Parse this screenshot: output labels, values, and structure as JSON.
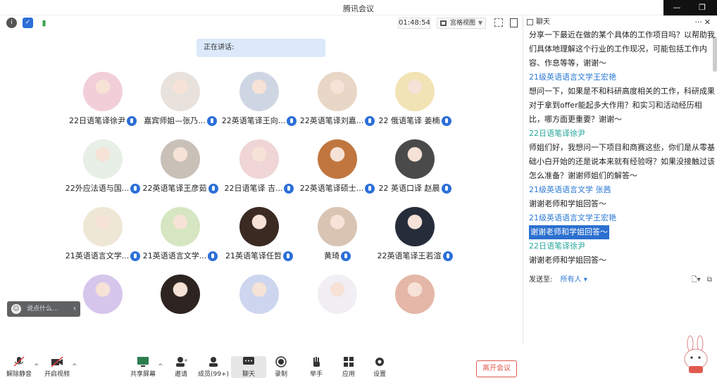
{
  "window": {
    "title": "腾讯会议"
  },
  "topbar": {
    "timer": "01:48:54",
    "view_mode": "宫格视图"
  },
  "speaking": {
    "label": "正在讲话:"
  },
  "participants": [
    {
      "name": "22日语笔译徐尹"
    },
    {
      "name": "嘉宾师姐—张乃..."
    },
    {
      "name": "22英语笔译王向..."
    },
    {
      "name": "22英语笔译刘嘉..."
    },
    {
      "name": "22 俄语笔译 姜楠"
    },
    {
      "name": "22外应法语与国..."
    },
    {
      "name": "22英语笔译王彦茹"
    },
    {
      "name": "22日语笔译 吉..."
    },
    {
      "name": "22英语笔译硕士..."
    },
    {
      "name": "22 英语口译 赵晨"
    },
    {
      "name": "21英语语言文学..."
    },
    {
      "name": "21英语语言文学..."
    },
    {
      "name": "21英语笔译任哲"
    },
    {
      "name": "黄琦"
    },
    {
      "name": "22英语笔译王若渲"
    },
    {
      "name": ""
    },
    {
      "name": ""
    },
    {
      "name": ""
    },
    {
      "name": ""
    },
    {
      "name": ""
    }
  ],
  "say_box": {
    "placeholder": "说点什么..."
  },
  "chat": {
    "title": "聊天",
    "messages": [
      {
        "type": "text",
        "text": "分享一下最近在做的某个具体的工作项目吗？以帮助我们具体地理解这个行业的工作现况，可能包括工作内容、作息等等，谢谢～"
      },
      {
        "type": "sender",
        "color": "blue",
        "text": "21级英语语言文学王宏艳"
      },
      {
        "type": "text",
        "text": "想问一下，如果是不和科研高度相关的工作，科研成果对于拿到offer能起多大作用？和实习和活动经历相比，哪方面更重要？谢谢～"
      },
      {
        "type": "sender",
        "color": "teal",
        "text": "22日语笔译徐尹"
      },
      {
        "type": "text",
        "text": "师姐们好，我想问一下项目和商赛这些，你们是从零基础小白开始的还是说本来就有经验呀？如果没接触过该怎么准备？谢谢师姐们的解答～"
      },
      {
        "type": "sender",
        "color": "blue",
        "text": "21级英语语言文学 张茜"
      },
      {
        "type": "text",
        "text": "谢谢老师和学姐回答～"
      },
      {
        "type": "sender",
        "color": "blue",
        "text": "21级英语语言文学王宏艳"
      },
      {
        "type": "highlight",
        "text": "谢谢老师和学姐回答～"
      },
      {
        "type": "sender",
        "color": "teal",
        "text": "22日语笔译徐尹"
      },
      {
        "type": "text",
        "text": "谢谢老师和学姐回答～"
      }
    ],
    "send_to_label": "发送至:",
    "send_to_value": "所有人"
  },
  "toolbar": {
    "unmute": "解除静音",
    "video": "开启视频",
    "share": "共享屏幕",
    "invite": "邀请",
    "members": "成员(99+)",
    "chat": "聊天",
    "record": "录制",
    "raise_hand": "举手",
    "apps": "应用",
    "settings": "设置",
    "leave": "离开会议"
  },
  "colors": {
    "accent_blue": "#2c6fd8",
    "leave_red": "#e05a4f",
    "teal": "#27a59a",
    "avatar_bgs": [
      "#f2cfd8",
      "#e9e2dc",
      "#cfd6e3",
      "#e8d6c6",
      "#f2e3b5",
      "#e8efe6",
      "#c9c1b8",
      "#efd5d5",
      "#c0763e",
      "#4a4a4a",
      "#efe7d6",
      "#d6e6c2",
      "#3a2a22",
      "#d9c4b4",
      "#262c3a",
      "#d6c6ec",
      "#2d2421",
      "#cdd6ee",
      "#f1eef4",
      "#e4b7a8"
    ]
  }
}
